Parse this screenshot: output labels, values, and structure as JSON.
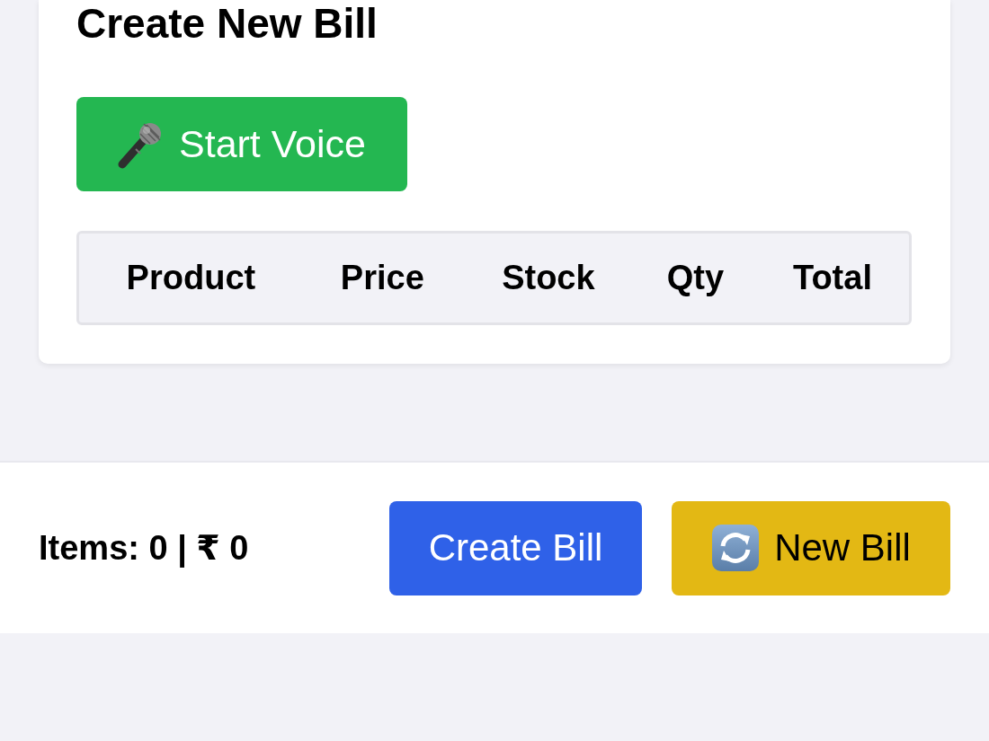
{
  "card": {
    "title": "Create New Bill",
    "voice_button": {
      "label": "Start Voice"
    },
    "table": {
      "columns": [
        "Product",
        "Price",
        "Stock",
        "Qty",
        "Total"
      ]
    }
  },
  "footer": {
    "summary": "Items: 0 | ₹ 0",
    "buttons": [
      {
        "label": "Create Bill",
        "kind": "primary"
      },
      {
        "label": "New Bill",
        "kind": "reset"
      }
    ]
  }
}
